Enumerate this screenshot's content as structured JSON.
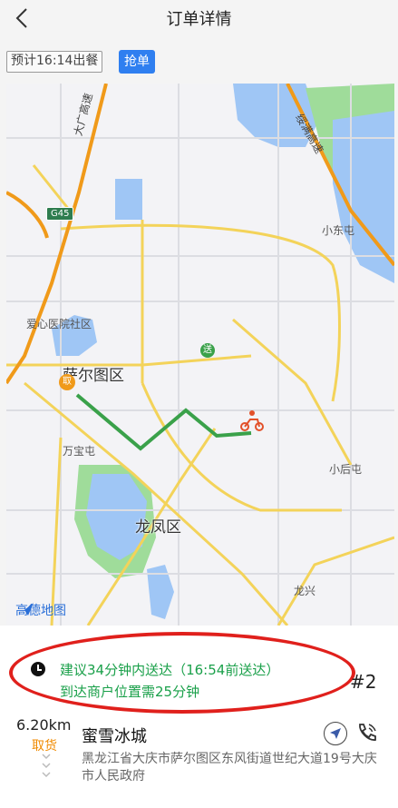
{
  "header": {
    "title": "订单详情"
  },
  "toolbar": {
    "eta_chip": "预计16:14出餐",
    "grab_button": "抢单"
  },
  "map": {
    "labels": {
      "highway_daguang": "大广高速",
      "highway_suiman": "绥满高速",
      "shield": "G45",
      "xiaodongtun": "小东屯",
      "aixin": "爱心医院社区",
      "saertu": "萨尔图区",
      "wanbaotun": "万宝屯",
      "xiaohoutun": "小后屯",
      "longfeng": "龙凤区",
      "longxing": "龙兴",
      "send_pin": "送",
      "pickup_pin": "取"
    },
    "logo_text": "高德地图",
    "colors": {
      "route": "#3aa14a",
      "highway": "#f09a1a",
      "water": "#9fc6f5",
      "park": "#9fdc9a"
    }
  },
  "panel": {
    "suggest": "建议34分钟内送达（16:54前送达）",
    "arrive": "到达商户位置需25分钟",
    "order_no": "#2",
    "distance": "6.20km",
    "pickup_tag": "取货",
    "shop_name": "蜜雪冰城",
    "address": "黑龙江省大庆市萨尔图区东风街道世纪大道19号大庆市人民政府"
  },
  "icons": {
    "back": "back-icon",
    "clock": "clock-icon",
    "navigate": "navigate-icon",
    "phone": "phone-icon",
    "rider": "rider-icon"
  }
}
